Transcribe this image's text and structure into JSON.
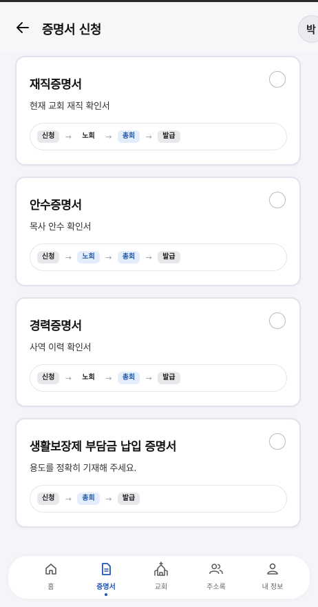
{
  "header": {
    "title": "증명서 신청",
    "avatar_text": "박"
  },
  "cards": [
    {
      "title": "재직증명서",
      "desc": "현재 교회 재직 확인서",
      "steps": [
        {
          "label": "신청",
          "style": "gray"
        },
        {
          "label": "노회",
          "style": "plain"
        },
        {
          "label": "총회",
          "style": "blue"
        },
        {
          "label": "발급",
          "style": "gray"
        }
      ]
    },
    {
      "title": "안수증명서",
      "desc": "목사 안수 확인서",
      "steps": [
        {
          "label": "신청",
          "style": "gray"
        },
        {
          "label": "노회",
          "style": "blue"
        },
        {
          "label": "총회",
          "style": "blue"
        },
        {
          "label": "발급",
          "style": "gray"
        }
      ]
    },
    {
      "title": "경력증명서",
      "desc": "사역 이력 확인서",
      "steps": [
        {
          "label": "신청",
          "style": "gray"
        },
        {
          "label": "노회",
          "style": "plain"
        },
        {
          "label": "총회",
          "style": "blue"
        },
        {
          "label": "발급",
          "style": "gray"
        }
      ]
    },
    {
      "title": "생활보장제 부담금 납입 증명서",
      "desc": "용도를 정확히 기재해 주세요.",
      "steps": [
        {
          "label": "신청",
          "style": "gray"
        },
        {
          "label": "총회",
          "style": "blue"
        },
        {
          "label": "발급",
          "style": "gray"
        }
      ]
    }
  ],
  "nav": [
    {
      "label": "홈",
      "icon": "home-icon",
      "active": false
    },
    {
      "label": "증명서",
      "icon": "document-icon",
      "active": true
    },
    {
      "label": "교회",
      "icon": "church-icon",
      "active": false
    },
    {
      "label": "주소록",
      "icon": "contacts-icon",
      "active": false
    },
    {
      "label": "내 정보",
      "icon": "profile-icon",
      "active": false
    }
  ],
  "colors": {
    "accent": "#1f55b3",
    "step_blue_bg": "#e3edfb",
    "step_gray_bg": "#e8e8ec"
  }
}
